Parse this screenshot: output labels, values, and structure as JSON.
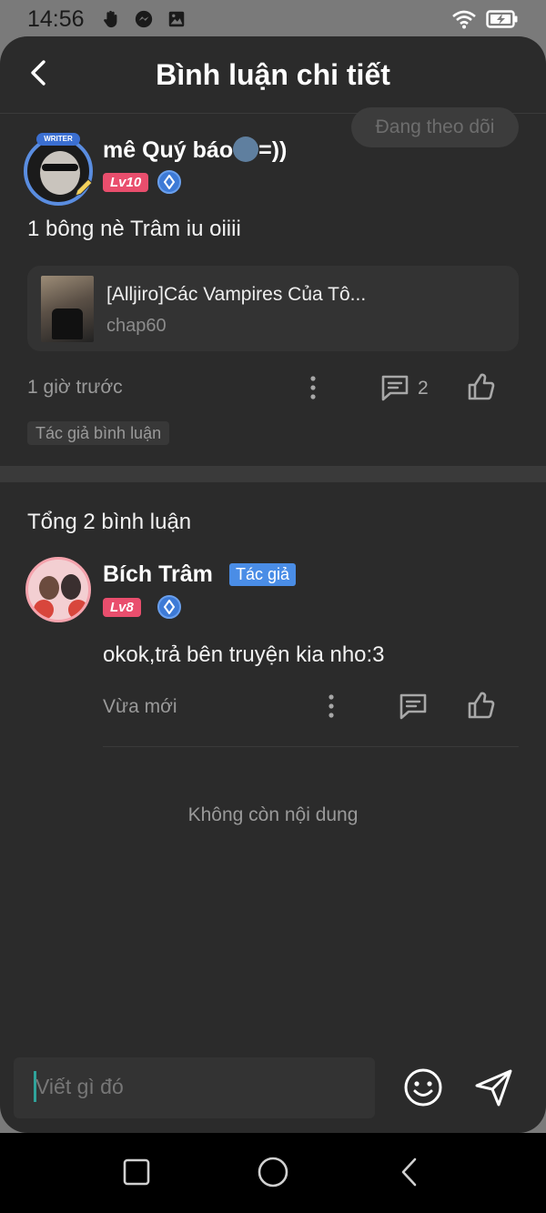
{
  "status_bar": {
    "time": "14:56",
    "icons_left": [
      "hand-icon",
      "messenger-icon",
      "image-icon"
    ],
    "icons_right": [
      "wifi-icon",
      "battery-charging-icon"
    ]
  },
  "header": {
    "title": "Bình luận chi tiết",
    "back_icon": "chevron-left-icon"
  },
  "main_comment": {
    "user_name": "mê Quý báo",
    "name_suffix": "=))",
    "level": "Lv10",
    "follow_label": "Đang theo dõi",
    "text": "1 bông nè Trâm iu oiiii",
    "story": {
      "title": "[Alljiro]Các Vampires Của Tô...",
      "chapter": "chap60"
    },
    "time": "1 giờ trước",
    "reply_count": "2",
    "author_tag": "Tác giả bình luận"
  },
  "replies": {
    "total_label": "Tổng 2 bình luận",
    "items": [
      {
        "user_name": "Bích Trâm",
        "author_label": "Tác giả",
        "level": "Lv8",
        "text": "okok,trả bên truyện kia nho:3",
        "time": "Vừa mới"
      }
    ],
    "end_message": "Không còn nội dung"
  },
  "input_bar": {
    "placeholder": "Viết gì đó"
  },
  "colors": {
    "background": "#2b2b2b",
    "level_badge": "#e94e6d",
    "author_label": "#4a8de6",
    "cursor": "#2fa39a"
  }
}
